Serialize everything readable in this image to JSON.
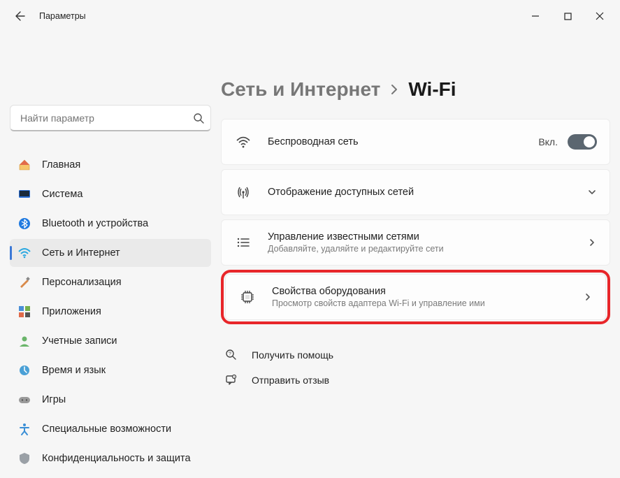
{
  "app": {
    "title": "Параметры"
  },
  "search": {
    "placeholder": "Найти параметр"
  },
  "sidebar": {
    "items": [
      {
        "label": "Главная"
      },
      {
        "label": "Система"
      },
      {
        "label": "Bluetooth и устройства"
      },
      {
        "label": "Сеть и Интернет"
      },
      {
        "label": "Персонализация"
      },
      {
        "label": "Приложения"
      },
      {
        "label": "Учетные записи"
      },
      {
        "label": "Время и язык"
      },
      {
        "label": "Игры"
      },
      {
        "label": "Специальные возможности"
      },
      {
        "label": "Конфиденциальность и защита"
      }
    ]
  },
  "breadcrumb": {
    "parent": "Сеть и Интернет",
    "current": "Wi-Fi"
  },
  "cards": {
    "wireless": {
      "title": "Беспроводная сеть",
      "state_label": "Вкл."
    },
    "available": {
      "title": "Отображение доступных сетей"
    },
    "known": {
      "title": "Управление известными сетями",
      "sub": "Добавляйте, удаляйте и редактируйте сети"
    },
    "hw": {
      "title": "Свойства оборудования",
      "sub": "Просмотр свойств адаптера Wi-Fi и управление ими"
    }
  },
  "footer": {
    "help": "Получить помощь",
    "feedback": "Отправить отзыв"
  }
}
